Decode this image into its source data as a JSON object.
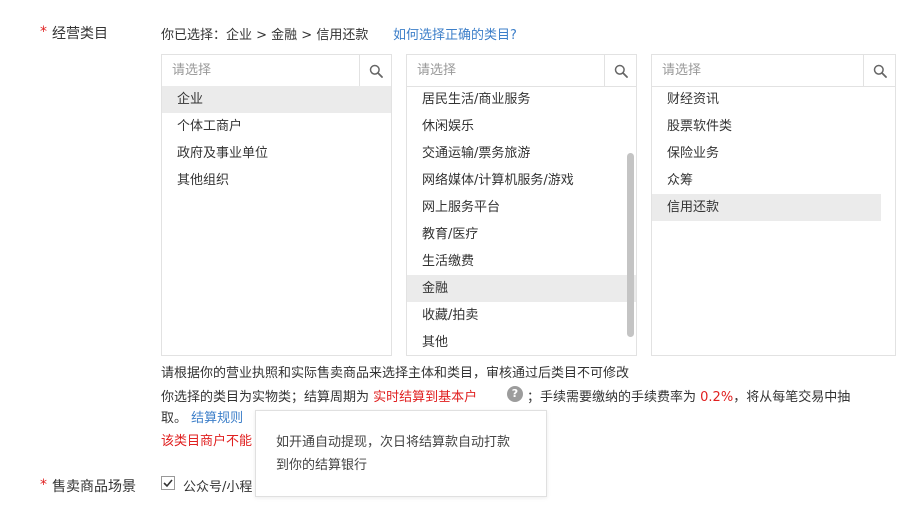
{
  "category": {
    "label": "经营类目",
    "required_mark": "*",
    "selected_prefix": "你已选择：",
    "selected_path": "企业 > 金融 > 信用还款",
    "help_link": "如何选择正确的类目?"
  },
  "columns": [
    {
      "placeholder": "请选择",
      "items": [
        "企业",
        "个体工商户",
        "政府及事业单位",
        "其他组织"
      ],
      "selected": "企业"
    },
    {
      "placeholder": "请选择",
      "items": [
        "居民生活/商业服务",
        "休闲娱乐",
        "交通运输/票务旅游",
        "网络媒体/计算机服务/游戏",
        "网上服务平台",
        "教育/医疗",
        "生活缴费",
        "金融",
        "收藏/拍卖",
        "其他"
      ],
      "selected": "金融"
    },
    {
      "placeholder": "请选择",
      "items": [
        "财经资讯",
        "股票软件类",
        "保险业务",
        "众筹",
        "信用还款"
      ],
      "selected": "信用还款"
    }
  ],
  "notes": {
    "line1": "请根据你的营业执照和实际售卖商品来选择主体和类目，审核通过后类目不可修改",
    "line2_prefix": "你选择的类目为实物类；结算周期为",
    "settlement": "实时结算到基本户",
    "line2_mid": "；手续需要缴纳的手续费率为",
    "fee_rate": "0.2%",
    "line2_suffix": "，将从每笔交易中抽",
    "line3_prefix": "取。",
    "rules_link": "结算规则",
    "warning": "该类目商户不能"
  },
  "tooltip": {
    "line1": "如开通自动提现，次日将结算款自动打款",
    "line2": "到你的结算银行"
  },
  "scene": {
    "label": "售卖商品场景",
    "required_mark": "*",
    "option": "公众号/小程"
  },
  "colors": {
    "link": "#3d7fc9",
    "required": "#e02020",
    "selected_bg": "#ebebeb"
  }
}
